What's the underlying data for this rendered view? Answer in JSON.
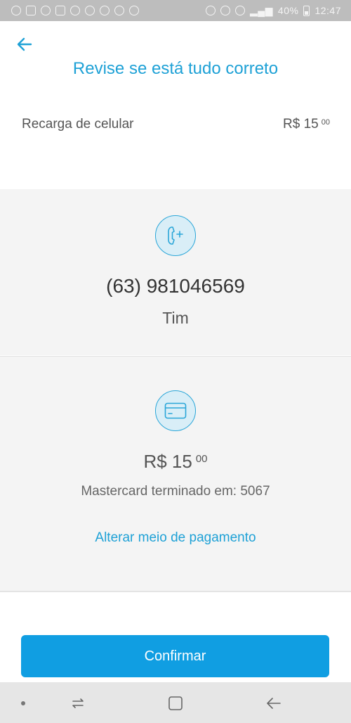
{
  "status_bar": {
    "battery": "40%",
    "time": "12:47"
  },
  "header": {
    "title": "Revise se está tudo correto"
  },
  "summary": {
    "label": "Recarga de celular",
    "amount": "R$ 15",
    "cents": "00"
  },
  "phone": {
    "number": "(63) 981046569",
    "carrier": "Tim"
  },
  "payment": {
    "amount": "R$ 15",
    "cents": "00",
    "card_description": "Mastercard terminado em: 5067",
    "change_label": "Alterar meio de pagamento"
  },
  "actions": {
    "confirm_label": "Confirmar"
  },
  "colors": {
    "accent": "#1ea1d6",
    "button": "#109ee2",
    "section_bg": "#f4f4f4"
  },
  "icons": {
    "back": "arrow-left-icon",
    "phone": "phone-add-icon",
    "card": "credit-card-icon"
  }
}
